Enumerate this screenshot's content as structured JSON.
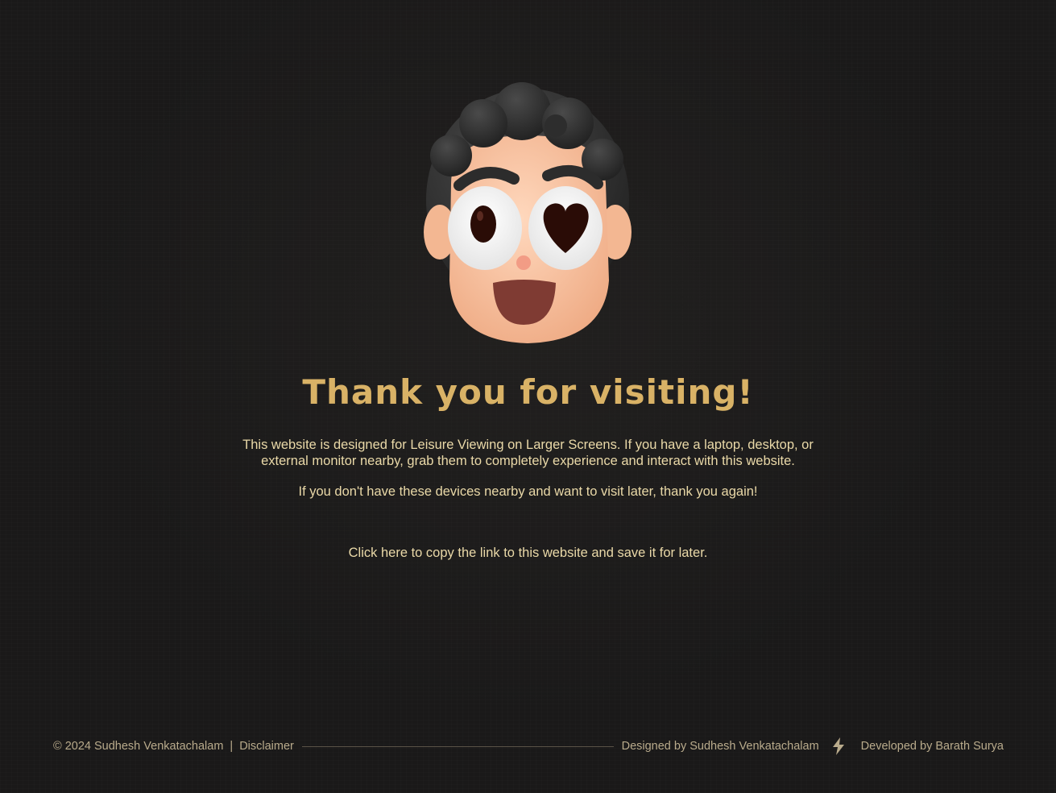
{
  "main": {
    "title": "Thank you for visiting!",
    "description_line1": "This website is designed for Leisure Viewing on Larger Screens. If you have a laptop, desktop, or external monitor nearby, grab them to completely experience and interact with this website.",
    "description_line2": "If you don't have these devices nearby and want to visit later, thank you again!",
    "copy_link": "Click here to copy the link to this website and save it for later."
  },
  "footer": {
    "copyright": "© 2024 Sudhesh Venkatachalam",
    "separator": "|",
    "disclaimer": "Disclaimer",
    "designed_by": "Designed by Sudhesh Venkatachalam",
    "developed_by": "Developed by Barath Surya",
    "bolt_icon": "lightning-bolt-icon"
  },
  "colors": {
    "background": "#1a1919",
    "accent": "#d9b266",
    "text": "#ead9a8",
    "footer_text": "#b9ab8c"
  }
}
